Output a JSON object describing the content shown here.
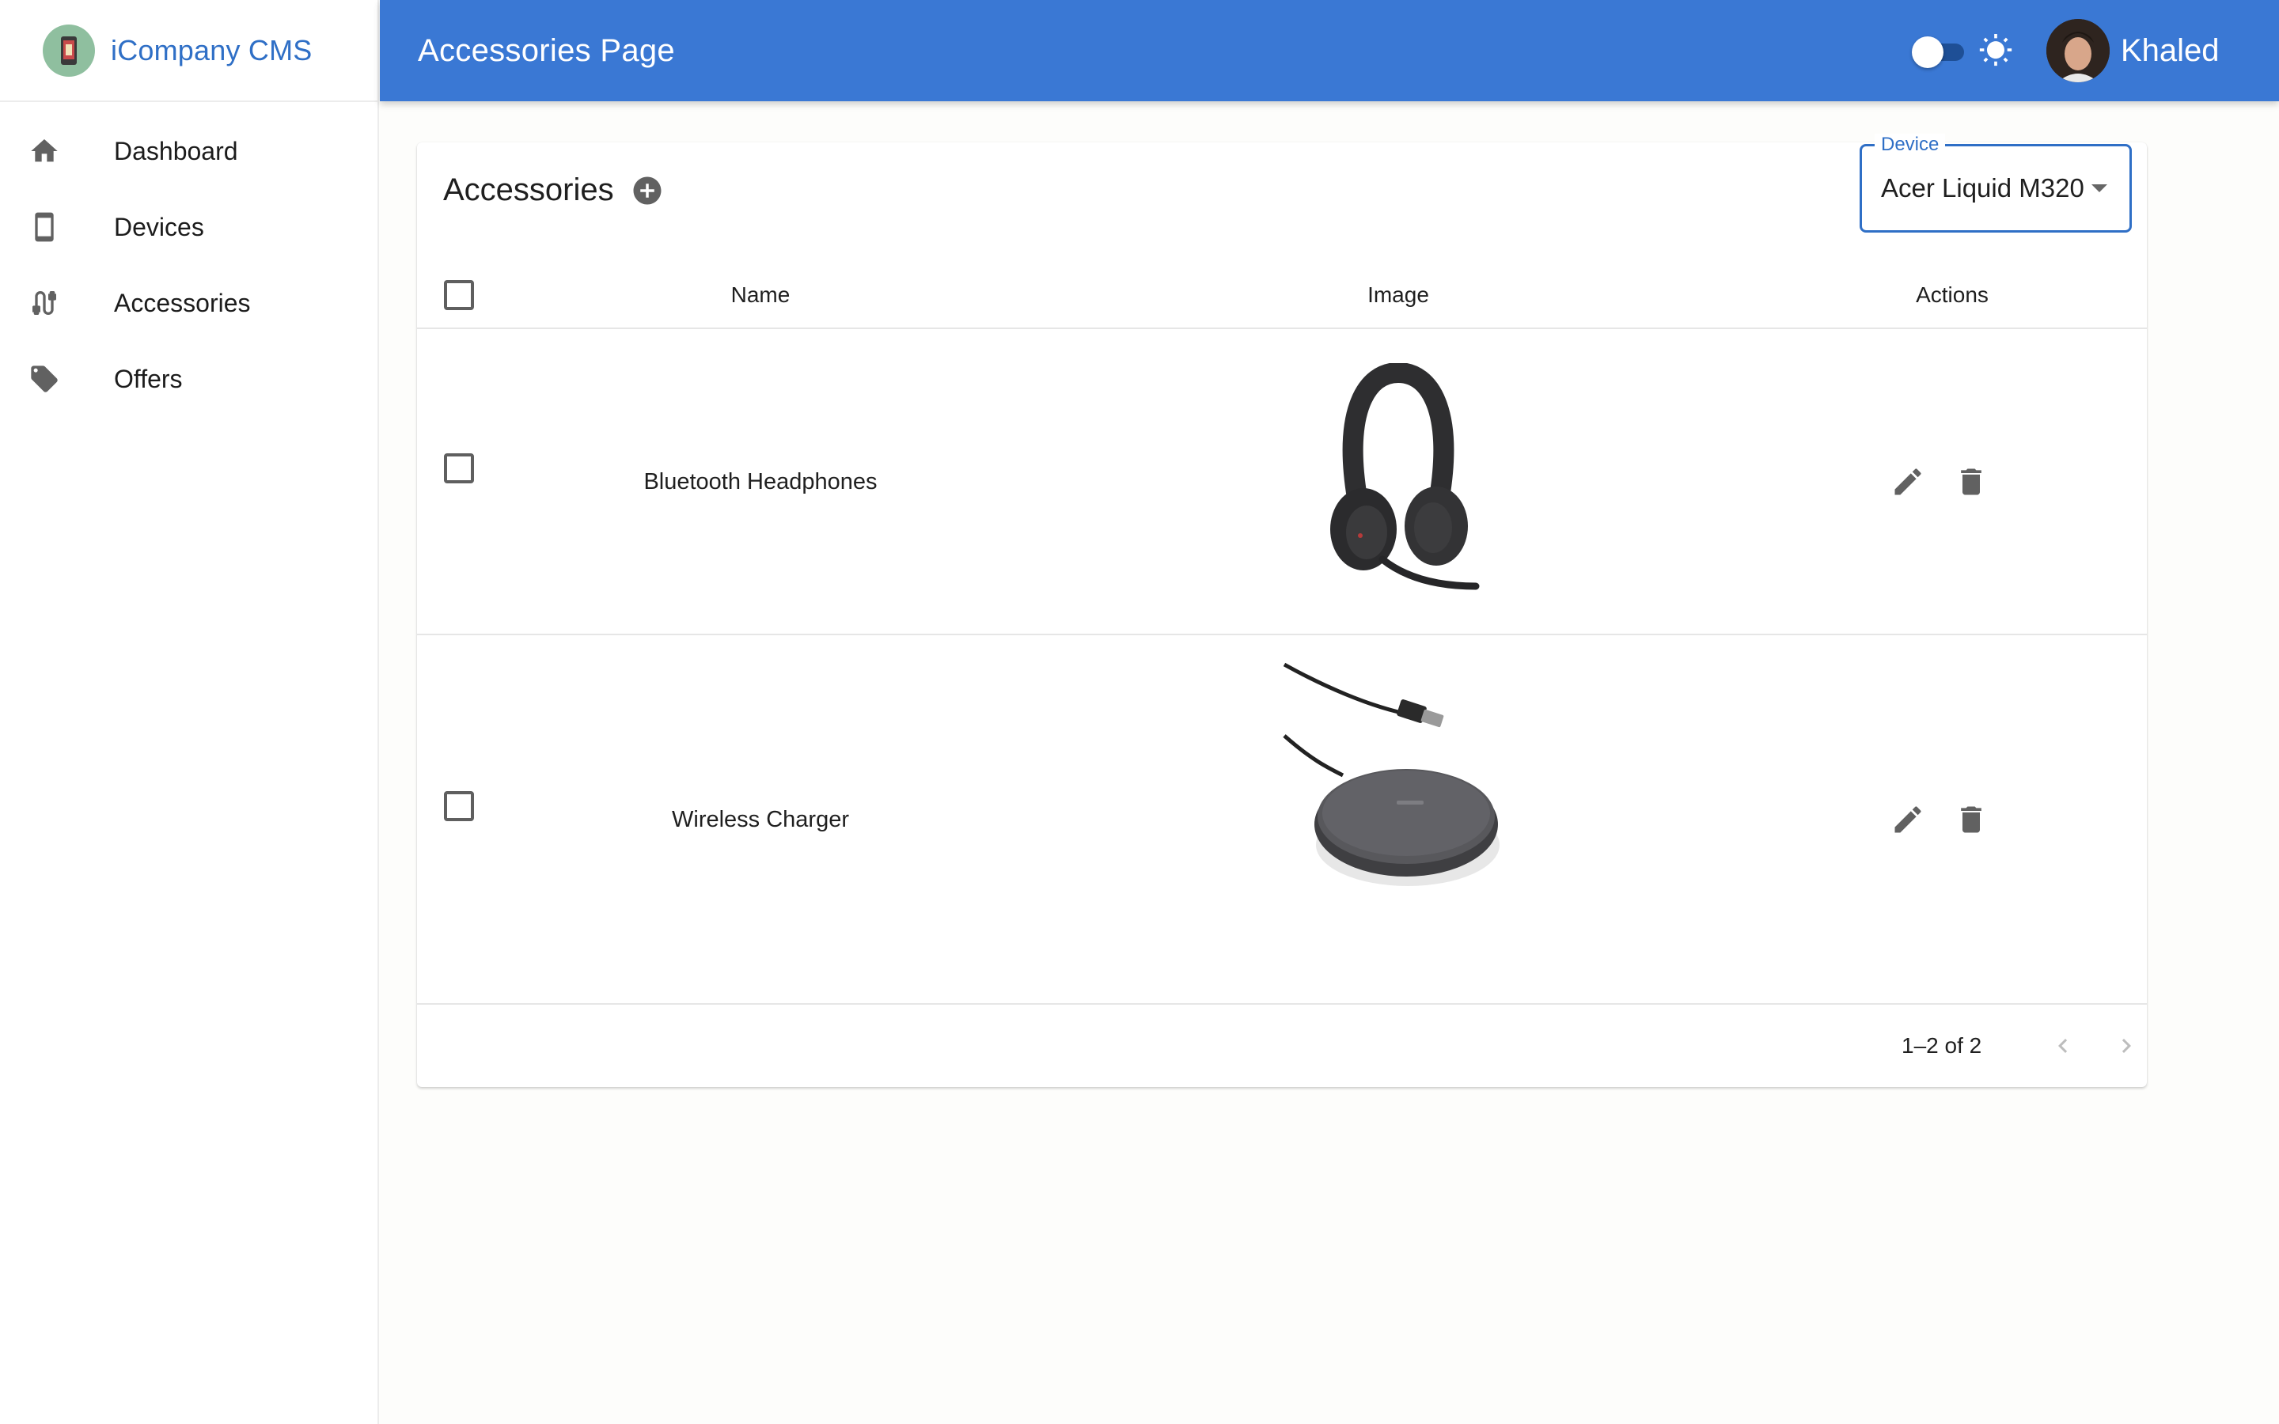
{
  "app": {
    "brand_title": "iCompany CMS"
  },
  "sidebar": {
    "items": [
      {
        "label": "Dashboard",
        "icon": "home-icon"
      },
      {
        "label": "Devices",
        "icon": "smartphone-icon"
      },
      {
        "label": "Accessories",
        "icon": "cable-icon"
      },
      {
        "label": "Offers",
        "icon": "tag-icon"
      }
    ]
  },
  "header": {
    "title": "Accessories Page",
    "theme_toggle_on": false,
    "user_name": "Khaled",
    "color": "#3a78d4"
  },
  "card": {
    "title": "Accessories",
    "device_filter": {
      "label": "Device",
      "value": "Acer Liquid M320"
    }
  },
  "table": {
    "columns": [
      "Name",
      "Image",
      "Actions"
    ],
    "rows": [
      {
        "name": "Bluetooth Headphones",
        "image": "headphones-image",
        "checked": false
      },
      {
        "name": "Wireless Charger",
        "image": "wireless-charger-image",
        "checked": false
      }
    ],
    "pagination": {
      "range": "1–2 of 2"
    }
  },
  "colors": {
    "accent": "#2f6fc6",
    "header_bg": "#3a78d4",
    "icon_gray": "#616161"
  }
}
